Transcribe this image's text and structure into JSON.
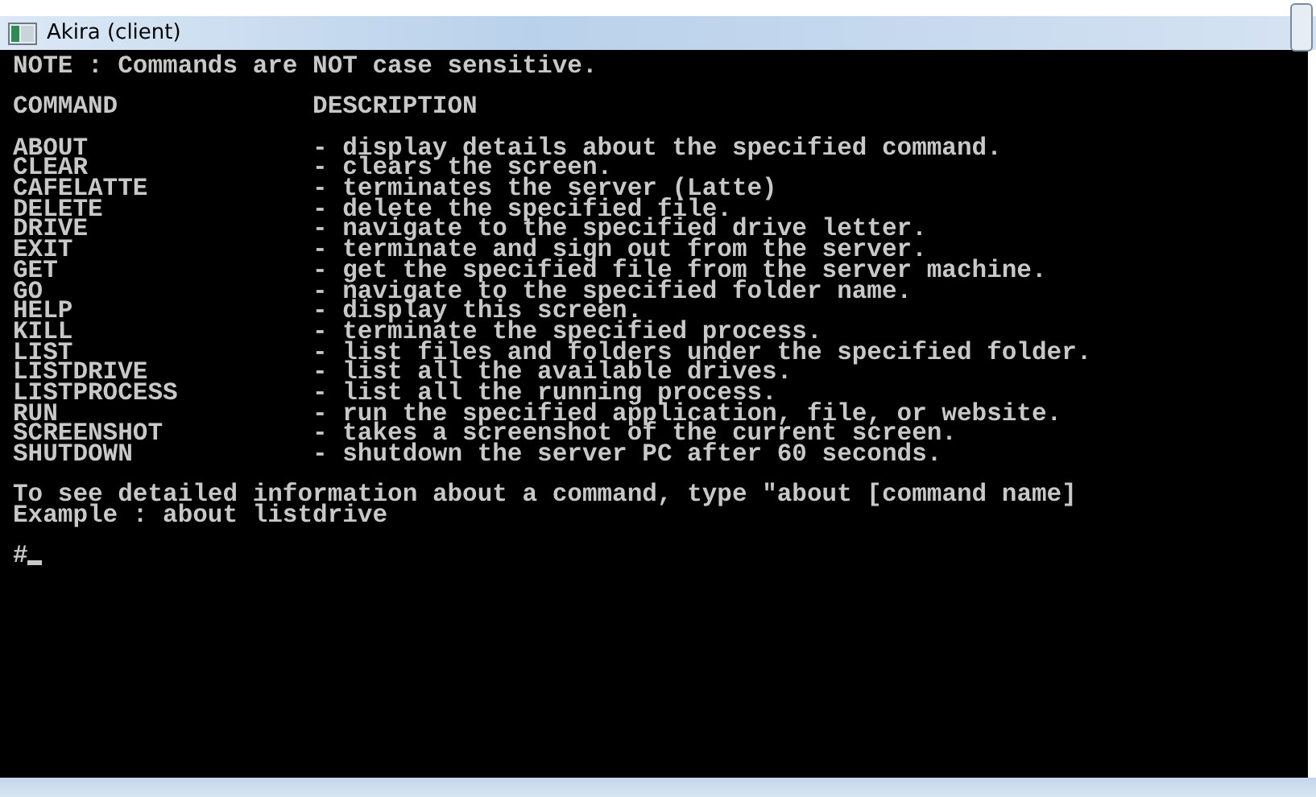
{
  "window": {
    "title": "Akira (client)"
  },
  "console": {
    "note": "NOTE : Commands are NOT case sensitive.",
    "headers": [
      "COMMAND",
      "DESCRIPTION"
    ],
    "commands": [
      {
        "name": "ABOUT",
        "description": "- display details about the specified command."
      },
      {
        "name": "CLEAR",
        "description": "- clears the screen."
      },
      {
        "name": "CAFELATTE",
        "description": "- terminates the server (Latte)"
      },
      {
        "name": "DELETE",
        "description": "- delete the specified file."
      },
      {
        "name": "DRIVE",
        "description": "- navigate to the specified drive letter."
      },
      {
        "name": "EXIT",
        "description": "- terminate and sign out from the server."
      },
      {
        "name": "GET",
        "description": "- get the specified file from the server machine."
      },
      {
        "name": "GO",
        "description": "- navigate to the specified folder name."
      },
      {
        "name": "HELP",
        "description": "- display this screen."
      },
      {
        "name": "KILL",
        "description": "- terminate the specified process."
      },
      {
        "name": "LIST",
        "description": "- list files and folders under the specified folder."
      },
      {
        "name": "LISTDRIVE",
        "description": "- list all the available drives."
      },
      {
        "name": "LISTPROCESS",
        "description": "- list all the running process."
      },
      {
        "name": "RUN",
        "description": "- run the specified application, file, or website."
      },
      {
        "name": "SCREENSHOT",
        "description": "- takes a screenshot of the current screen."
      },
      {
        "name": "SHUTDOWN",
        "description": "- shutdown the server PC after 60 seconds."
      }
    ],
    "footer": [
      "To see detailed information about a command, type \"about [command name]",
      "Example : about listdrive"
    ],
    "prompt": "#"
  }
}
